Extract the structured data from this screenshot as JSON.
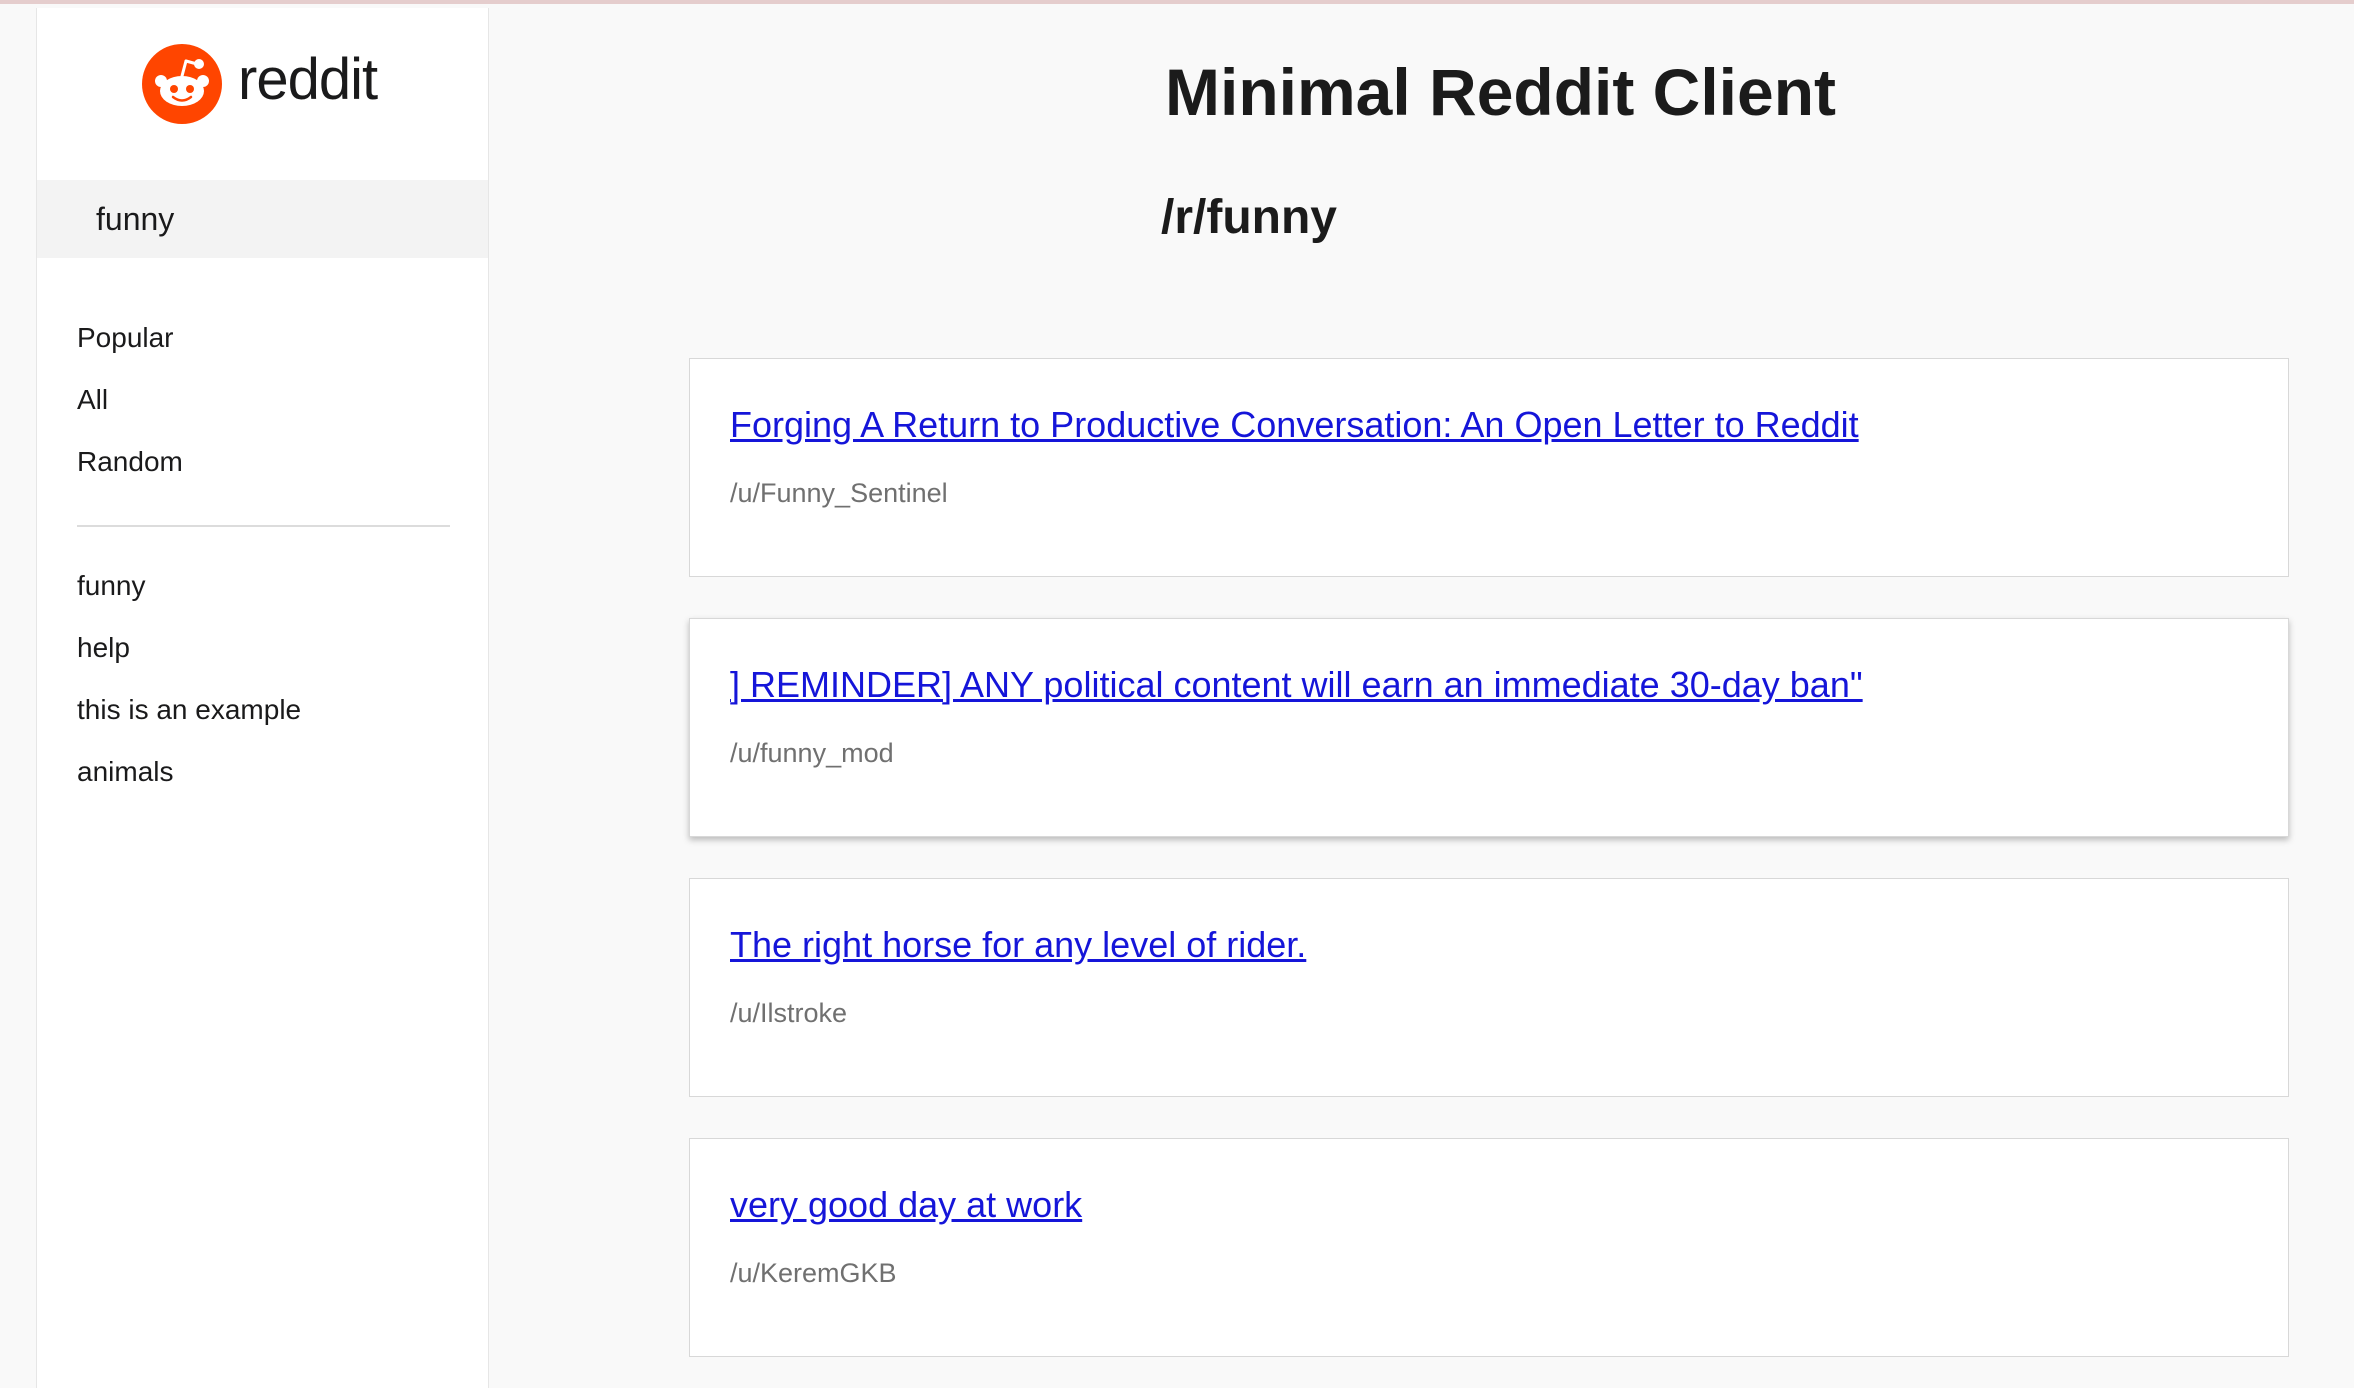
{
  "brand": {
    "name": "reddit",
    "color": "#ff4500"
  },
  "sidebar": {
    "search_value": "funny",
    "nav_items": [
      {
        "label": "Popular"
      },
      {
        "label": "All"
      },
      {
        "label": "Random"
      }
    ],
    "subreddits": [
      {
        "label": "funny"
      },
      {
        "label": "help"
      },
      {
        "label": "this is an example"
      },
      {
        "label": "animals"
      }
    ]
  },
  "main": {
    "title": "Minimal Reddit Client",
    "subreddit_heading": "/r/funny",
    "posts": [
      {
        "title": "Forging A Return to Productive Conversation: An Open Letter to Reddit",
        "author": "/u/Funny_Sentinel"
      },
      {
        "title": "] REMINDER] ANY political content will earn an immediate 30-day ban\"",
        "author": "/u/funny_mod"
      },
      {
        "title": "The right horse for any level of rider.",
        "author": "/u/Ilstroke"
      },
      {
        "title": "very good day at work",
        "author": "/u/KeremGKB"
      }
    ]
  },
  "colors": {
    "link": "#1515d9",
    "author": "#707070",
    "page_background": "#f9f9f9"
  }
}
